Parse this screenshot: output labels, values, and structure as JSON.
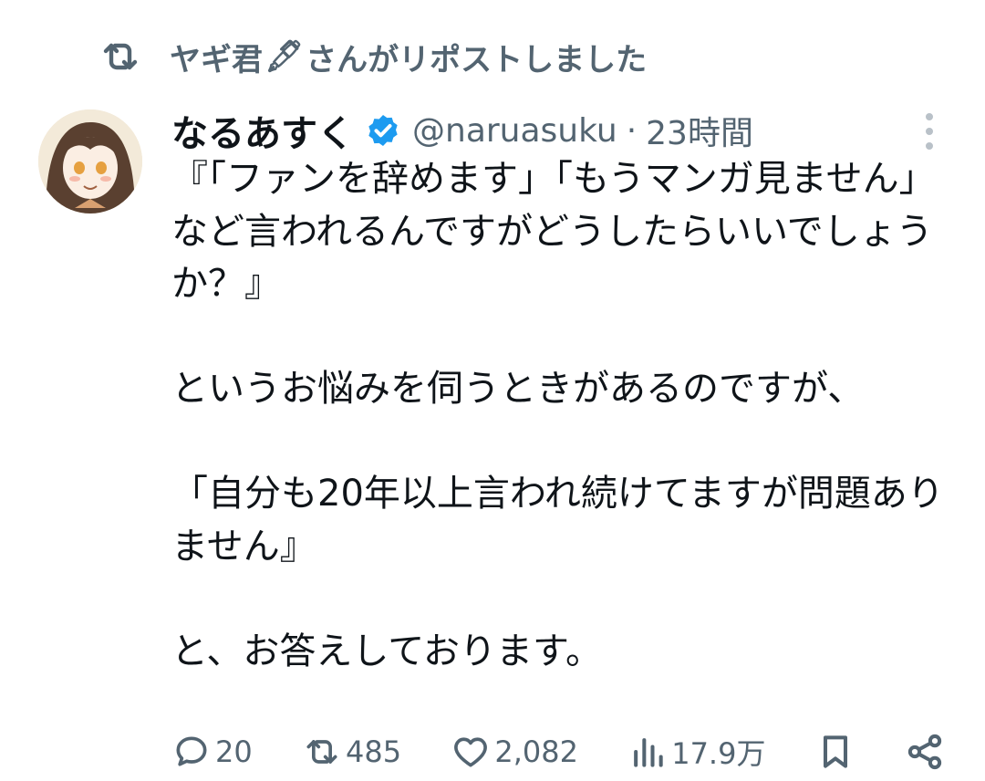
{
  "repost": {
    "user_name": "ヤギ君",
    "user_emoji": "🖋",
    "suffix": "さんがリポストしました"
  },
  "tweet": {
    "display_name": "なるあすく",
    "handle": "@naruasuku",
    "separator": "·",
    "time": "23時間",
    "text": "『「ファンを辞めます」「もうマンガ見ません」など言われるんですがどうしたらいいでしょうか？』\n\nというお悩みを伺うときがあるのですが、\n\n「自分も20年以上言われ続けてますが問題ありません』\n\nと、お答えしております。"
  },
  "metrics": {
    "replies": "20",
    "reposts": "485",
    "likes": "2,082",
    "views": "17.9万"
  },
  "icons": {
    "repost": "repost-icon",
    "verified": "verified-badge-icon",
    "more": "more-dots-icon",
    "reply": "reply-icon",
    "like": "heart-icon",
    "views": "views-chart-icon",
    "bookmark": "bookmark-icon",
    "share": "share-icon"
  },
  "colors": {
    "text_primary": "#0f1419",
    "text_secondary": "#536471",
    "verified_blue": "#1d9bf0"
  }
}
